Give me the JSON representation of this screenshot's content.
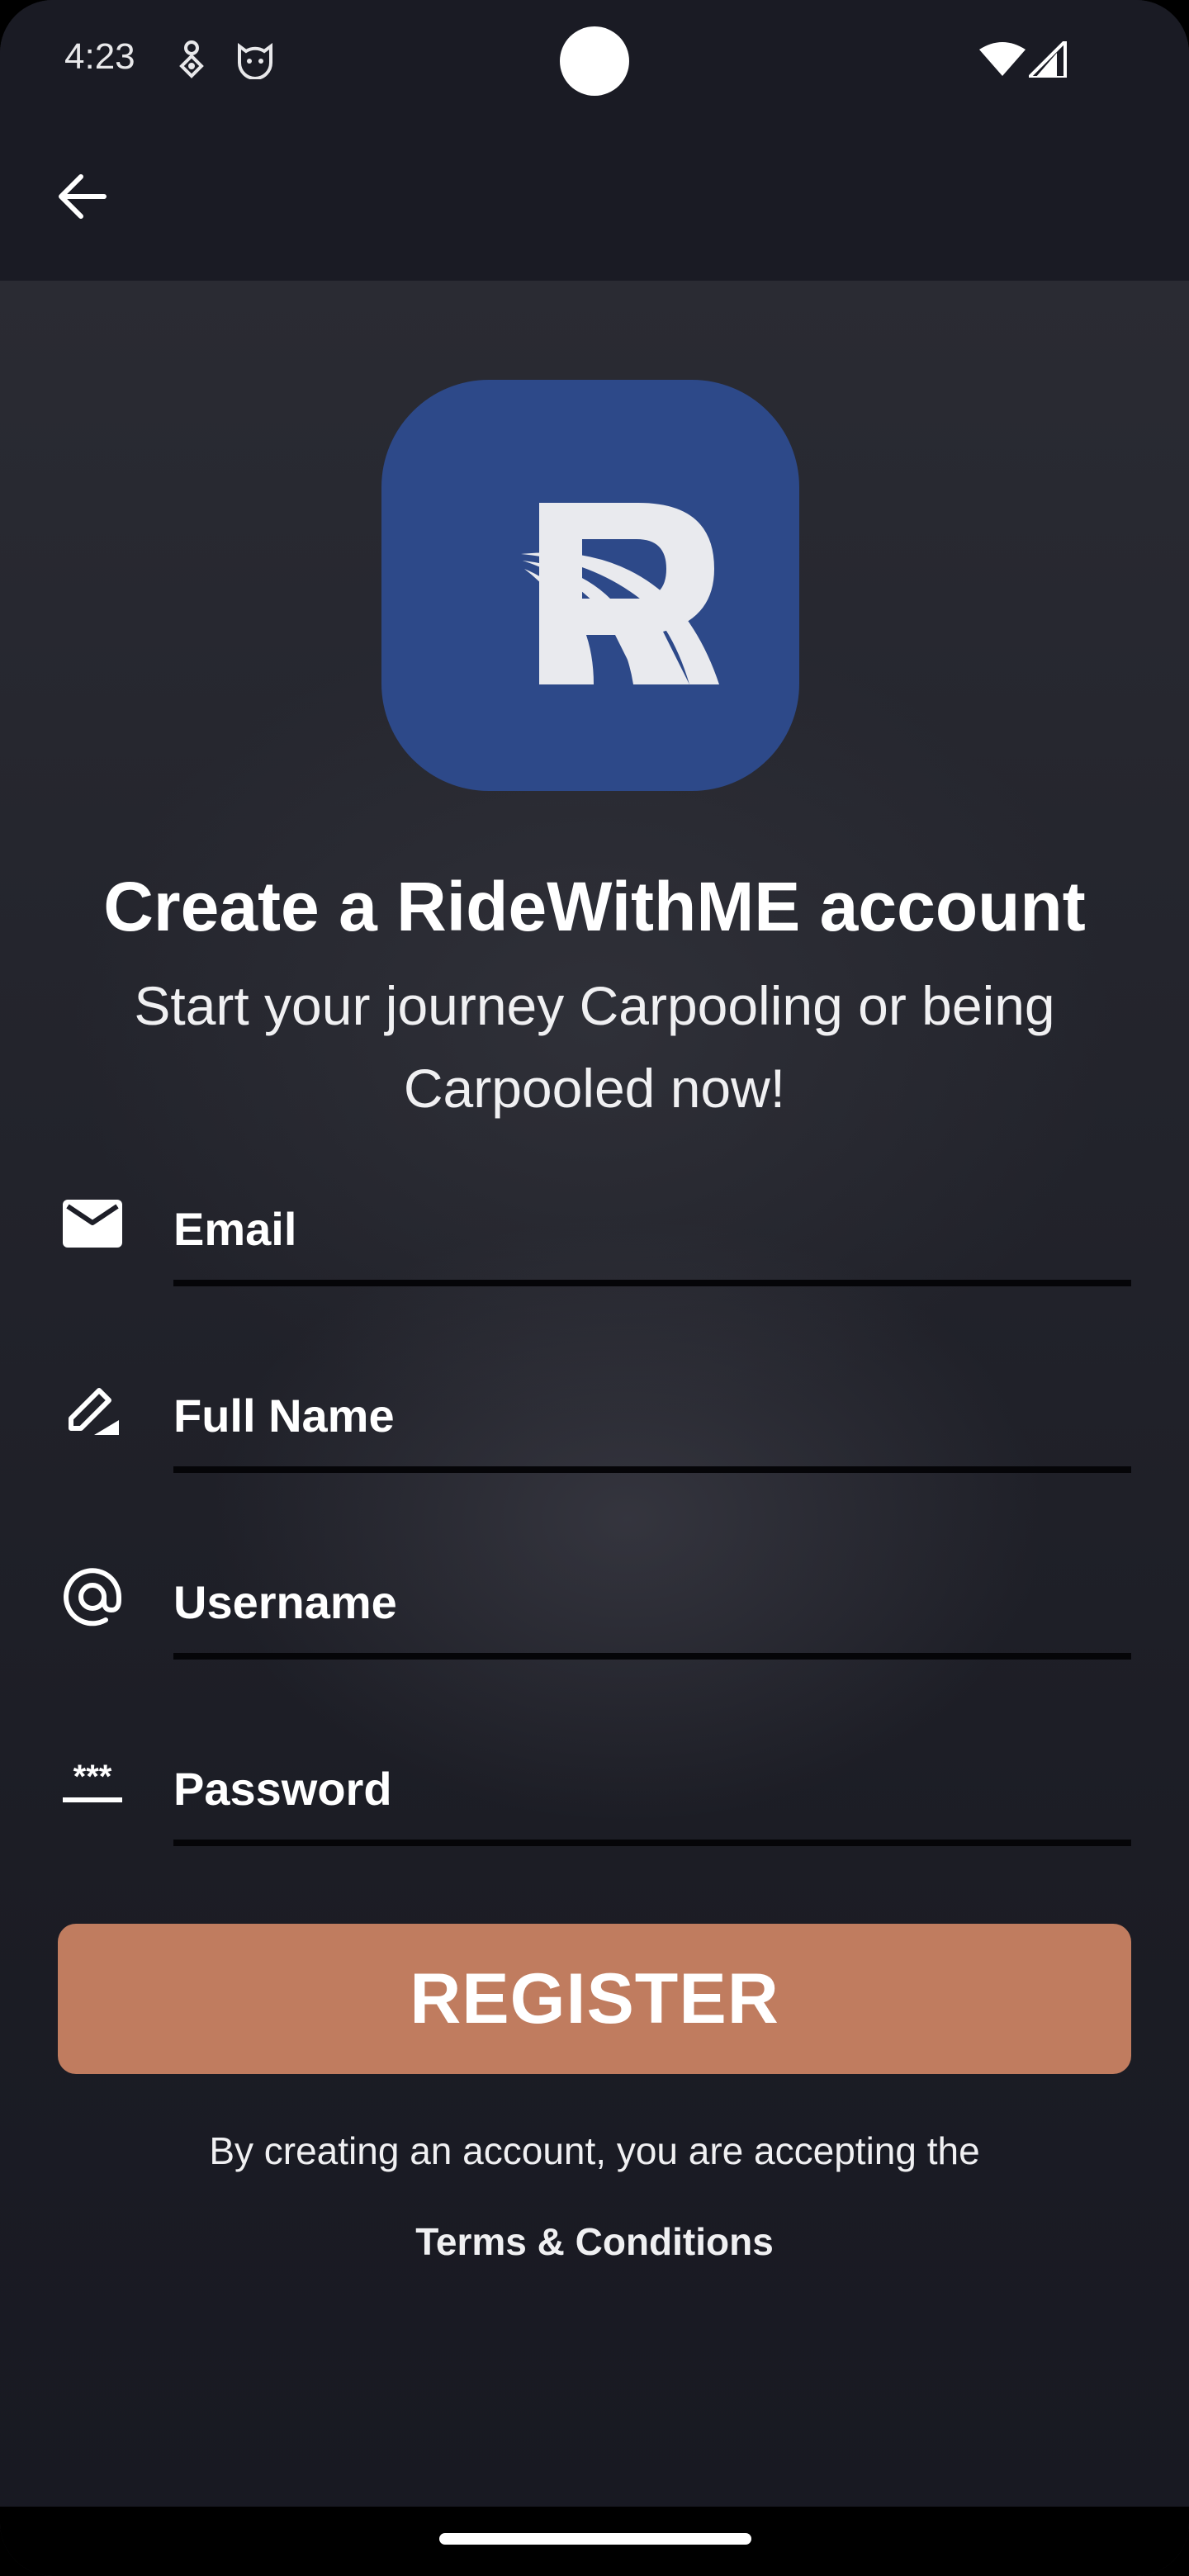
{
  "status_bar": {
    "time": "4:23",
    "icons": [
      "notification-icon",
      "cat-face-icon",
      "wifi-icon",
      "cell-signal-icon"
    ]
  },
  "app_bar": {
    "back_icon": "arrow-back-icon"
  },
  "logo": {
    "letter": "R",
    "background_color": "#2d4989"
  },
  "header": {
    "title": "Create a RideWithME account",
    "subtitle_line1": "Start your journey Carpooling or being",
    "subtitle_line2": "Carpooled now!"
  },
  "form": {
    "email": {
      "placeholder": "Email",
      "value": "",
      "icon": "mail-icon"
    },
    "full_name": {
      "placeholder": "Full Name",
      "value": "",
      "icon": "edit-pen-icon"
    },
    "username": {
      "placeholder": "Username",
      "value": "",
      "icon": "at-sign-icon"
    },
    "password": {
      "placeholder": "Password",
      "value": "",
      "icon": "password-icon"
    }
  },
  "register_button": {
    "label": "REGISTER",
    "color": "#c07c5f"
  },
  "footer": {
    "accept_text": "By creating an account, you are accepting the",
    "terms_link": "Terms & Conditions"
  }
}
